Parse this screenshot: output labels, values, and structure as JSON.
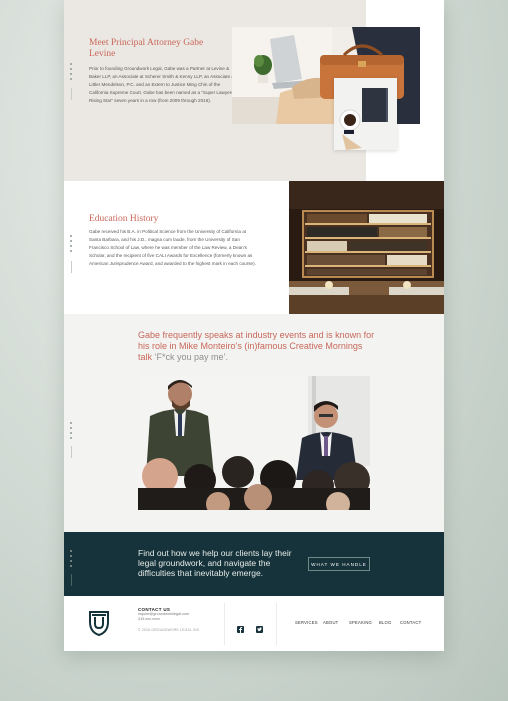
{
  "attorney": {
    "title": "Meet Principal Attorney Gabe Levine",
    "bio": "Prior to founding Groundwork Legal, Gabe was a Partner at Levine & Baker LLP, an Associate at Scherer Smith & Kenny LLP, an Associate at Littler Mendelson, P.C. and an Extern to Justice Ming Chin of the California Supreme Court. Gabe has been named as a “Super Lawyers Rising Star” seven years in a row (from 2009 through 2016)."
  },
  "education": {
    "title": "Education History",
    "text": "Gabe received his B.A. in Political Science from the University of California at Santa Barbara, and his J.D., magna cum laude, from the University of San Francisco School of Law, where he was member of the Law Review, a Dean’s Scholar, and the recipient of five CALI Awards for Excellence (formerly known as American Jurisprudence Award, and awarded to the highest mark in each course)."
  },
  "speaking": {
    "quote": "Gabe frequently speaks at industry events and is known for his role in Mike Monteiro’s (in)famous Creative Mornings talk ",
    "quote_link": "‘F*ck you pay me’."
  },
  "cta": {
    "text": "Find out how we help our clients lay their legal groundwork, and navigate the difficulties that inevitably emerge.",
    "button": "WHAT WE HANDLE"
  },
  "footer": {
    "contact_heading": "CONTACT US",
    "email": "inquire@groundworklegal.com",
    "phone": "415.xxx.xxxx",
    "copyright": "© 2016 GROUNDWORK LEGAL INC.",
    "nav": [
      "SERVICES",
      "ABOUT",
      "SPEAKING",
      "BLOG",
      "CONTACT"
    ]
  },
  "colors": {
    "accent": "#c8685a",
    "dark": "#16323a",
    "beige": "#ebe7e2"
  }
}
